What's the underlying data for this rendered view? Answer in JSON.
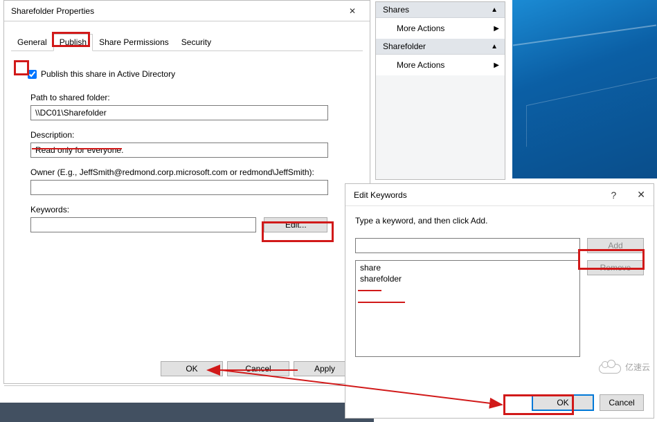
{
  "properties": {
    "title": "Sharefolder Properties",
    "tabs": {
      "general": "General",
      "publish": "Publish",
      "share_permissions": "Share Permissions",
      "security": "Security"
    },
    "publish_checkbox_label": "Publish this share in Active Directory",
    "publish_checked": true,
    "path_label": "Path to shared folder:",
    "path_value": "\\\\DC01\\Sharefolder",
    "description_label": "Description:",
    "description_value": "Read only for everyone.",
    "owner_label": "Owner (E.g., JeffSmith@redmond.corp.microsoft.com or redmond\\JeffSmith):",
    "owner_value": "",
    "keywords_label": "Keywords:",
    "keywords_value": "",
    "edit_button": "Edit...",
    "buttons": {
      "ok": "OK",
      "cancel": "Cancel",
      "apply": "Apply"
    }
  },
  "mmc": {
    "sections": [
      {
        "title": "Shares",
        "item": "More Actions"
      },
      {
        "title": "Sharefolder",
        "item": "More Actions"
      }
    ]
  },
  "keywords_dialog": {
    "title": "Edit Keywords",
    "instruction": "Type a keyword, and then click Add.",
    "add_button": "Add",
    "remove_button": "Remove",
    "list": [
      "share",
      "sharefolder"
    ],
    "ok": "OK",
    "cancel": "Cancel"
  },
  "watermark": "亿速云"
}
